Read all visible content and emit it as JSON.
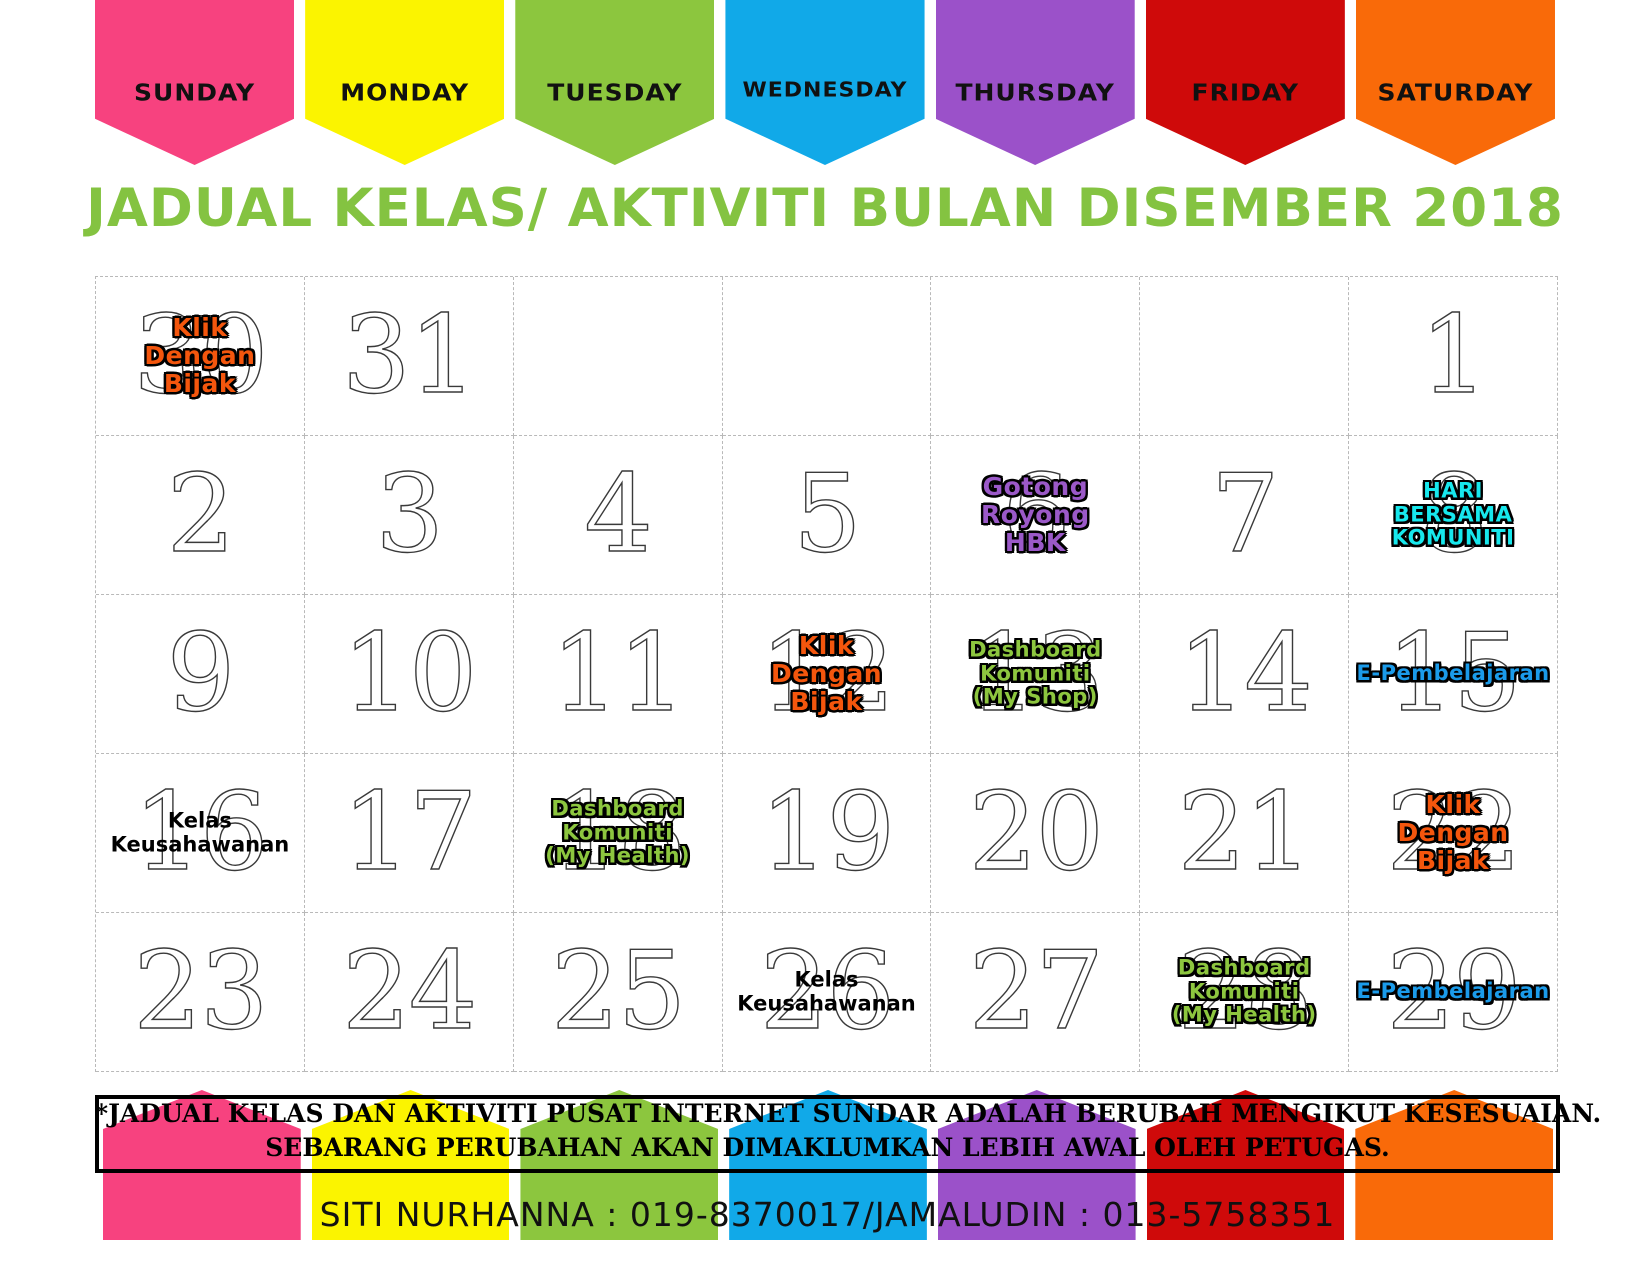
{
  "header": {
    "days": [
      {
        "label": "SUNDAY",
        "color": "#f7427f"
      },
      {
        "label": "MONDAY",
        "color": "#fbf400"
      },
      {
        "label": "TUESDAY",
        "color": "#8cc63e"
      },
      {
        "label": "WEDNESDAY",
        "color": "#11a9e8"
      },
      {
        "label": "THURSDAY",
        "color": "#9b51c9"
      },
      {
        "label": "FRIDAY",
        "color": "#cf0a0a"
      },
      {
        "label": "SATURDAY",
        "color": "#f96a09"
      }
    ]
  },
  "title": {
    "text": "JADUAL KELAS/ AKTIVITI BULAN DISEMBER  2018",
    "color": "#84c341"
  },
  "calendar": {
    "month": "DISEMBER",
    "year": "2018",
    "weeks": [
      [
        {
          "day": "30",
          "event": [
            "Klik",
            "Dengan",
            "Bijak"
          ],
          "style": "ev-orange"
        },
        {
          "day": "31",
          "event": [],
          "style": ""
        },
        {
          "day": "",
          "event": [],
          "style": ""
        },
        {
          "day": "",
          "event": [],
          "style": ""
        },
        {
          "day": "",
          "event": [],
          "style": ""
        },
        {
          "day": "",
          "event": [],
          "style": ""
        },
        {
          "day": "1",
          "event": [],
          "style": ""
        }
      ],
      [
        {
          "day": "2",
          "event": [],
          "style": ""
        },
        {
          "day": "3",
          "event": [],
          "style": ""
        },
        {
          "day": "4",
          "event": [],
          "style": ""
        },
        {
          "day": "5",
          "event": [],
          "style": ""
        },
        {
          "day": "6",
          "event": [
            "Gotong",
            "Royong",
            "HBK"
          ],
          "style": "ev-purple"
        },
        {
          "day": "7",
          "event": [],
          "style": ""
        },
        {
          "day": "8",
          "event": [
            "HARI",
            "BERSAMA",
            "KOMUNITI"
          ],
          "style": "ev-cyan ev-small"
        }
      ],
      [
        {
          "day": "9",
          "event": [],
          "style": ""
        },
        {
          "day": "10",
          "event": [],
          "style": ""
        },
        {
          "day": "11",
          "event": [],
          "style": ""
        },
        {
          "day": "12",
          "event": [
            "Klik",
            "Dengan",
            "Bijak"
          ],
          "style": "ev-orange"
        },
        {
          "day": "13",
          "event": [
            "Dashboard",
            "Komuniti",
            "(My Shop)"
          ],
          "style": "ev-green ev-small"
        },
        {
          "day": "14",
          "event": [],
          "style": ""
        },
        {
          "day": "15",
          "event": [
            "E-Pembelajaran"
          ],
          "style": "ev-blue ev-small"
        }
      ],
      [
        {
          "day": "16",
          "event": [
            "Kelas",
            "Keusahawanan"
          ],
          "style": "ev-black ev-small"
        },
        {
          "day": "17",
          "event": [],
          "style": ""
        },
        {
          "day": "18",
          "event": [
            "Dashboard",
            "Komuniti",
            "(My Health)"
          ],
          "style": "ev-green ev-small"
        },
        {
          "day": "19",
          "event": [],
          "style": ""
        },
        {
          "day": "20",
          "event": [],
          "style": ""
        },
        {
          "day": "21",
          "event": [],
          "style": ""
        },
        {
          "day": "22",
          "event": [
            "Klik",
            "Dengan",
            "Bijak"
          ],
          "style": "ev-orange"
        }
      ],
      [
        {
          "day": "23",
          "event": [],
          "style": ""
        },
        {
          "day": "24",
          "event": [],
          "style": ""
        },
        {
          "day": "25",
          "event": [],
          "style": ""
        },
        {
          "day": "26",
          "event": [
            "Kelas",
            "Keusahawanan"
          ],
          "style": "ev-black ev-small"
        },
        {
          "day": "27",
          "event": [],
          "style": ""
        },
        {
          "day": "28",
          "event": [
            "Dashboard",
            "Komuniti",
            "(My Health)"
          ],
          "style": "ev-green ev-small"
        },
        {
          "day": "29",
          "event": [
            "E-Pembelajaran"
          ],
          "style": "ev-blue ev-small"
        }
      ]
    ]
  },
  "footer": {
    "note_line1": "*JADUAL KELAS DAN AKTIVITI PUSAT INTERNET SUNDAR ADALAH BERUBAH MENGIKUT KESESUAIAN.",
    "note_line2": "SEBARANG PERUBAHAN AKAN DIMAKLUMKAN LEBIH AWAL OLEH PETUGAS.",
    "contact": "SITI NURHANNA : 019-8370017/JAMALUDIN : 013-5758351",
    "tab_colors": [
      "#f7427f",
      "#fbf400",
      "#8cc63e",
      "#11a9e8",
      "#9b51c9",
      "#cf0a0a",
      "#f96a09"
    ]
  }
}
